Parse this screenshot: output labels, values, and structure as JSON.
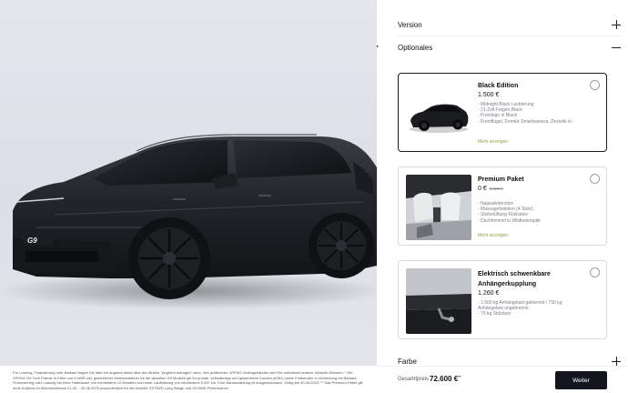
{
  "accordion": {
    "version_label": "Version",
    "options_label": "Optionales",
    "color_label": "Farbe"
  },
  "options": [
    {
      "title": "Black Edition",
      "price": "1.500 €",
      "old_price": "",
      "features": [
        "- Midnight Black Lackierung",
        "- 21-Zoll-Felgen Black",
        "- Frontlogo in Black",
        "- Frontflügel, Frontür-Smartkamera, Ziertelle in"
      ],
      "more": "Mehr anzeigen",
      "selected": true
    },
    {
      "title": "Premium Paket",
      "price": "0 €",
      "old_price": "3.500 €",
      "features": [
        "- Nappaledersitze",
        "- Massagefunktion (4 Sitze)",
        "- Sitzbelüftung Rücksitze",
        "- Dachhimmel in Wildlederoptik"
      ],
      "more": "Mehr anzeigen",
      "selected": false
    },
    {
      "title": "Elektrisch schwenkbare Anhängerkupplung",
      "price": "1.260 €",
      "old_price": "",
      "features": [
        "- 1.500 kg Anhängelast gebremst / 750 kg",
        "Anhängelast ungebremst",
        "- 75 kg Stützlast"
      ],
      "more": "",
      "selected": false
    }
  ],
  "vehicle": {
    "plate_text": "G9"
  },
  "footer": {
    "disclaimer": "Für Leasing, Finanzierung oder Barkauf fragen Sie bitte ein Angebot direkt über den Button \"Angebot anfragen\" nach. Ihre präferierter XPENG-Vertragshändler wird Sie individuell beraten. Aktuelle Aktionen: * Die XPENG G9 Tech Prämie in Höhe von 5.000€ inkl. gesetzlicher Mehrwertsteuer für die aktuellen G9 Modelle gilt für private, selbständige und gewerbliche Kunden (KMU) sowie Freiberufler in Verbindung mit Barkauf, Finanzierung oder Leasing bei einer Haltedauer von mindestens 12 Monaten und einer Laufleistung von mindestens 5.000 km. Eine Barauszahlung ist ausgeschlossen. Gültig bis 30.06.2025. ** Das Premium-Paket gilt ohne Aufpreis im Aktionszeitraum 01.04. - 30.06.2025 ausschließlich für die Modelle G9 RWD Long Range und G9 AWD Performance."
  },
  "summary": {
    "total_label": "Gesamtpreis",
    "total_value": "72.600 €",
    "chevron": "⌃",
    "next_label": "Weiter"
  },
  "colors": {
    "accent_link": "#8fa54a",
    "button_bg": "#14161f",
    "stage_bg": "#e0e3e9"
  }
}
